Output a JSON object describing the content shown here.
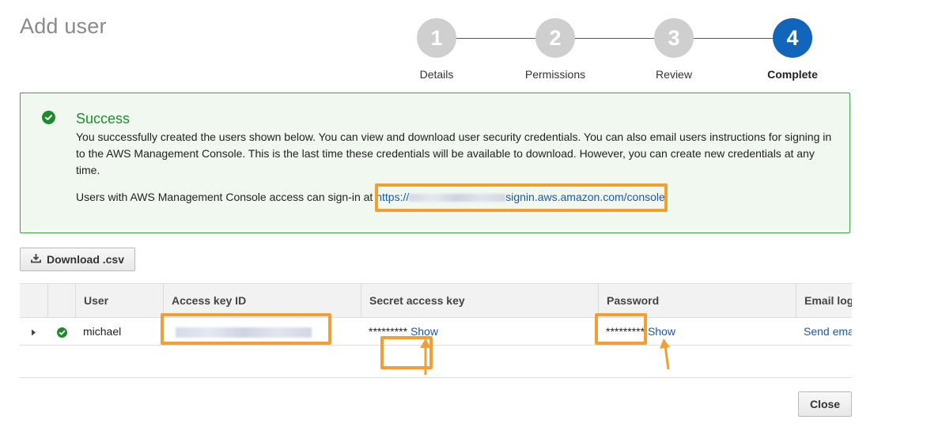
{
  "page": {
    "title": "Add user"
  },
  "steps": [
    {
      "number": "1",
      "label": "Details",
      "active": false
    },
    {
      "number": "2",
      "label": "Permissions",
      "active": false
    },
    {
      "number": "3",
      "label": "Review",
      "active": false
    },
    {
      "number": "4",
      "label": "Complete",
      "active": true
    }
  ],
  "success": {
    "title": "Success",
    "body": "You successfully created the users shown below. You can view and download user security credentials. You can also email users instructions for signing in to the AWS Management Console. This is the last time these credentials will be available to download. However, you can create new credentials at any time.",
    "signin_prefix": "Users with AWS Management Console access can sign-in at",
    "signin_url_start": "https://",
    "signin_url_end": "signin.aws.amazon.com/console"
  },
  "toolbar": {
    "download_label": "Download .csv"
  },
  "table": {
    "headers": {
      "user": "User",
      "access_key_id": "Access key ID",
      "secret_access_key": "Secret access key",
      "password": "Password",
      "email_login": "Email log"
    },
    "rows": [
      {
        "user": "michael",
        "secret_masked": "*********",
        "secret_show": "Show",
        "password_masked": "*********",
        "password_show": "Show",
        "email_action": "Send ema"
      }
    ]
  },
  "footer": {
    "close_label": "Close"
  },
  "colors": {
    "accent": "#1166bb",
    "success": "#1f8d2c",
    "highlight": "#f0a033",
    "link": "#1558b0"
  }
}
